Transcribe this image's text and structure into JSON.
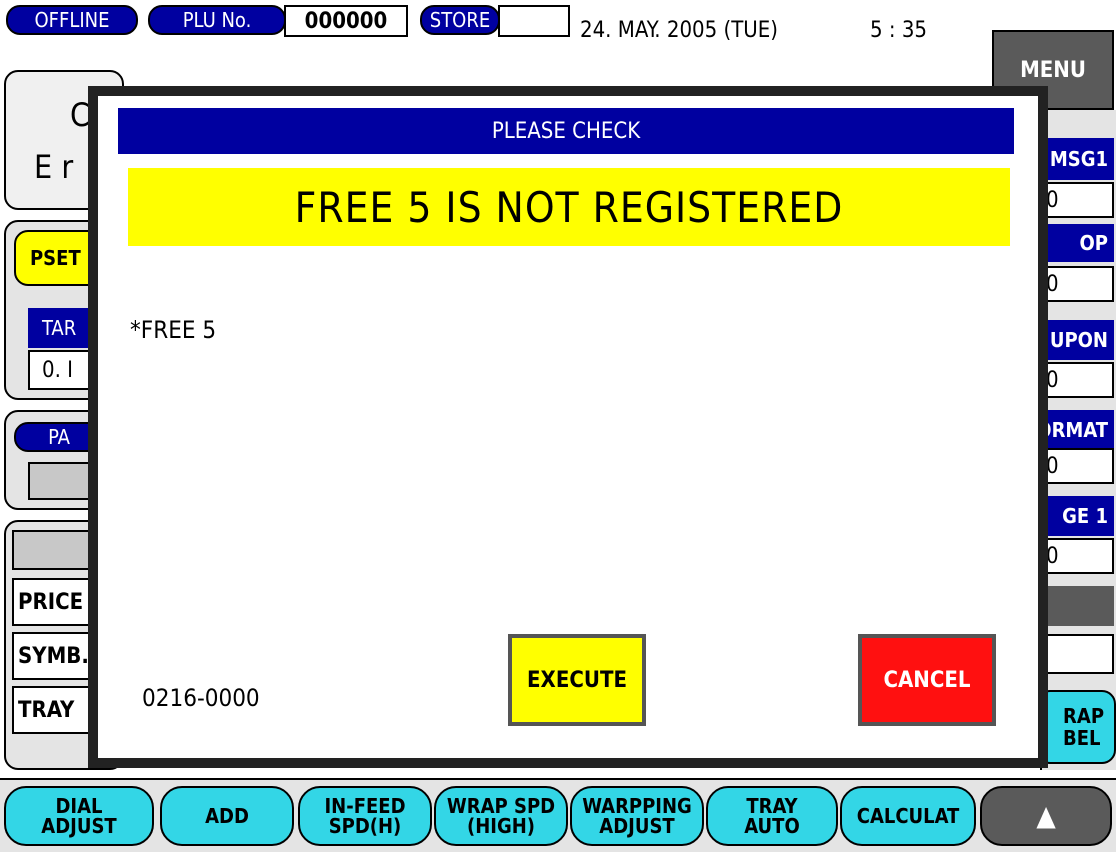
{
  "header": {
    "mode": "OFFLINE",
    "plu_label": "PLU No.",
    "plu_value": "000000",
    "store_label": "STORE",
    "store_value": "",
    "date": "24. MAY. 2005 (TUE)",
    "time": "5 : 35",
    "menu": "MENU"
  },
  "left_panel": {
    "title_partial_1": "C",
    "title_partial_2": "E r",
    "pset_partial": "PSET",
    "tare_partial": "TAR",
    "tare_value_partial": "0. I",
    "pa_partial": "PA",
    "rows": [
      "PRICE",
      "SYMB.",
      "TRAY"
    ]
  },
  "right_panel": {
    "items": [
      {
        "label": "MSG1",
        "value": "0"
      },
      {
        "label": "OP",
        "value": "0"
      },
      {
        "label": "UPON",
        "value": "0"
      },
      {
        "label": "ORMAT",
        "value": "0"
      },
      {
        "label": "GE 1",
        "value": "0"
      }
    ],
    "wrap_label_button": "RAP\nBEL"
  },
  "dialog": {
    "title": "PLEASE CHECK",
    "message": "FREE 5   IS NOT REGISTERED",
    "detail": "*FREE 5",
    "code": "0216-0000",
    "execute": "EXECUTE",
    "cancel": "CANCEL"
  },
  "bottom_bar": [
    "DIAL\nADJUST",
    "ADD",
    "IN-FEED\nSPD(H)",
    "WRAP SPD\n(HIGH)",
    "WARPPING\nADJUST",
    "TRAY\nAUTO",
    "CALCULAT",
    "▲"
  ],
  "colors": {
    "header_blue": "#0000a0",
    "cyan": "#33d6e6",
    "yellow": "#ffff00",
    "red": "#ff1010",
    "menu_gray": "#5a5a5a"
  }
}
